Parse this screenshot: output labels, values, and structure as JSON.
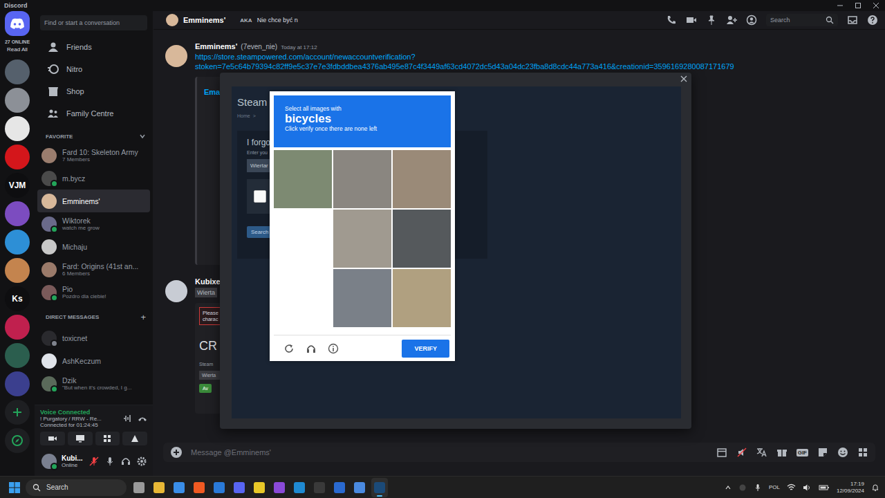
{
  "window": {
    "title": "Discord"
  },
  "servers": {
    "online": "27 ONLINE",
    "read_all": "Read All",
    "items": [
      {
        "color": "#55606c"
      },
      {
        "color": "#8c9097"
      },
      {
        "color": "#e6e6e6"
      },
      {
        "color": "#d4161b"
      },
      {
        "label": "VJM",
        "color": "#0e0e10"
      },
      {
        "color": "#7c4cc0"
      },
      {
        "color": "#2d8fd6"
      },
      {
        "color": "#c4844e"
      },
      {
        "label": "Ks",
        "color": "#0e0e10"
      },
      {
        "color": "#c0204e"
      },
      {
        "color": "#2b5e4e"
      },
      {
        "color": "#3b3f8e"
      }
    ]
  },
  "sidebar": {
    "search": {
      "placeholder": "Find or start a conversation"
    },
    "nav": [
      {
        "label": "Friends",
        "selected": false
      },
      {
        "label": "Nitro",
        "selected": false
      },
      {
        "label": "Shop",
        "selected": false
      },
      {
        "label": "Family Centre",
        "selected": false
      }
    ],
    "favorite": {
      "title": "FAVORITE",
      "expanded": true,
      "items": [
        {
          "name": "Fard 10: Skeleton Army",
          "subtitle": "7 Members",
          "selected": false,
          "status": "none",
          "color": "#9a7d6e"
        },
        {
          "name": "m.bycz",
          "selected": false,
          "status": "online",
          "color": "#4a4a4a"
        },
        {
          "name": "Emminems'",
          "selected": true,
          "status": "none",
          "color": "#d8b89a"
        },
        {
          "name": "Wiktorek",
          "subtitle": "watch me grow",
          "selected": false,
          "status": "online",
          "color": "#6a6a8a"
        },
        {
          "name": "Michaju",
          "selected": false,
          "status": "none",
          "color": "#c8c8c8"
        },
        {
          "name": "Fard: Origins (41st an...",
          "subtitle": "6 Members",
          "selected": false,
          "status": "none",
          "color": "#9a7a6a"
        },
        {
          "name": "Pio",
          "subtitle": "Pozdro dla ciebie!",
          "selected": false,
          "status": "online",
          "color": "#7a5a5a"
        }
      ]
    },
    "direct_messages": {
      "title": "DIRECT MESSAGES",
      "add": "+",
      "items": [
        {
          "name": "toxicnet",
          "selected": false,
          "status": "offline",
          "color": "#2a2a2e"
        },
        {
          "name": "AshKeczum",
          "selected": false,
          "status": "none",
          "color": "#e0e4ea"
        },
        {
          "name": "Dzik",
          "subtitle": "\"But when it's crowded, I g...",
          "selected": false,
          "status": "online",
          "color": "#5a6a5a"
        }
      ]
    },
    "voice": {
      "status": "Voice Connected",
      "channel": "! Purgatory / RRW - Re...",
      "duration": "Connected for 01:24:45"
    },
    "user": {
      "name": "Kubi...",
      "status": "Online",
      "muted": true
    }
  },
  "header": {
    "name": "Emminems'",
    "aka": "AKA",
    "nickname": "Nie chce być n",
    "search": "Search"
  },
  "messages": [
    {
      "author": "Emminems'",
      "handle": "(7even_nie)",
      "time": "Today at 17:12",
      "links": [
        "https://store.steampowered.com/account/newaccountverification?",
        "stoken=7e5c64b79394c82ff9e5c37e7e3fdbddbea4376ab495e87c4f3449af63cd4072dc5d43a04dc23fba8d8cdc44a773a416&creationid=3596169280087171679"
      ],
      "embed": {
        "title": "Ema"
      }
    },
    {
      "author": "Kubixe",
      "highlight": "Wierta",
      "embed": {
        "notice": [
          "Please",
          "charac"
        ],
        "title": "CR",
        "label": "Steam",
        "field": "Wierta",
        "badge": "Av"
      }
    }
  ],
  "input": {
    "placeholder": "Message @Emminems'",
    "gif": "GIF"
  },
  "modal": {
    "page": {
      "title": "Steam",
      "breadcrumb": [
        "Home",
        ">"
      ],
      "heading": "I forgo",
      "hint": "Enter you",
      "field": "Wiertar",
      "button": "Search"
    },
    "captcha": {
      "prompt": "Select all images with",
      "target": "bicycles",
      "instruction": "Click verify once there are none left",
      "tiles": [
        {
          "loaded": true,
          "color": "#7d8a72"
        },
        {
          "loaded": true,
          "color": "#8a8680"
        },
        {
          "loaded": true,
          "color": "#9a8a78"
        },
        {
          "loaded": false,
          "color": "#ffffff"
        },
        {
          "loaded": true,
          "color": "#a09a90"
        },
        {
          "loaded": true,
          "color": "#55595c"
        },
        {
          "loaded": false,
          "color": "#ffffff"
        },
        {
          "loaded": true,
          "color": "#7a8088"
        },
        {
          "loaded": true,
          "color": "#b0a080"
        }
      ],
      "verify": "VERIFY"
    }
  },
  "taskbar": {
    "search": "Search",
    "apps": [
      {
        "color": "#9a9a9a",
        "active": false
      },
      {
        "color": "#e8b836",
        "active": false
      },
      {
        "color": "#3a8ee8",
        "active": false
      },
      {
        "color": "#f05a22",
        "active": false
      },
      {
        "color": "#2a7ad8",
        "active": false
      },
      {
        "color": "#5865f2",
        "active": false
      },
      {
        "color": "#e8c828",
        "active": false
      },
      {
        "color": "#8a4ad8",
        "active": false
      },
      {
        "color": "#1f8ad2",
        "active": false
      },
      {
        "color": "#3a3a3a",
        "active": false
      },
      {
        "color": "#2a6ad0",
        "active": false
      },
      {
        "color": "#4a8ae0",
        "active": false
      },
      {
        "color": "#1b4a78",
        "active": true
      }
    ],
    "language": "POL",
    "time": "17:19",
    "date": "12/09/2024"
  }
}
